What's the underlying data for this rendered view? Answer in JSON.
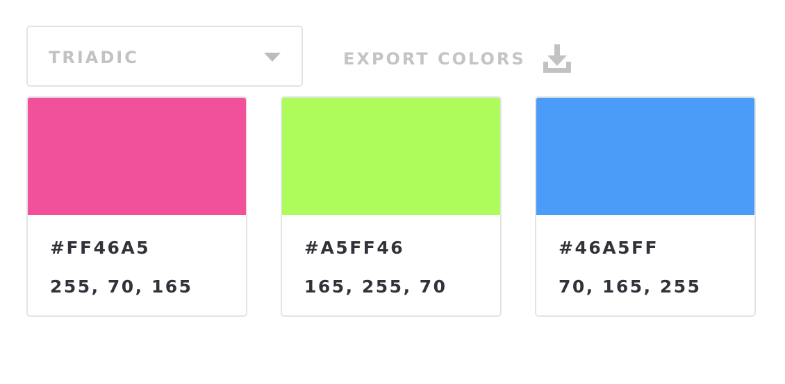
{
  "scheme_select": {
    "label": "TRIADIC"
  },
  "export": {
    "label": "EXPORT COLORS",
    "icon": "download-icon"
  },
  "colors": [
    {
      "hex": "#FF46A5",
      "rgb": "255, 70, 165",
      "swatch": "#F0519A"
    },
    {
      "hex": "#A5FF46",
      "rgb": "165, 255, 70",
      "swatch": "#AEFB5C"
    },
    {
      "hex": "#46A5FF",
      "rgb": "70, 165, 255",
      "swatch": "#4A9CF8"
    }
  ]
}
